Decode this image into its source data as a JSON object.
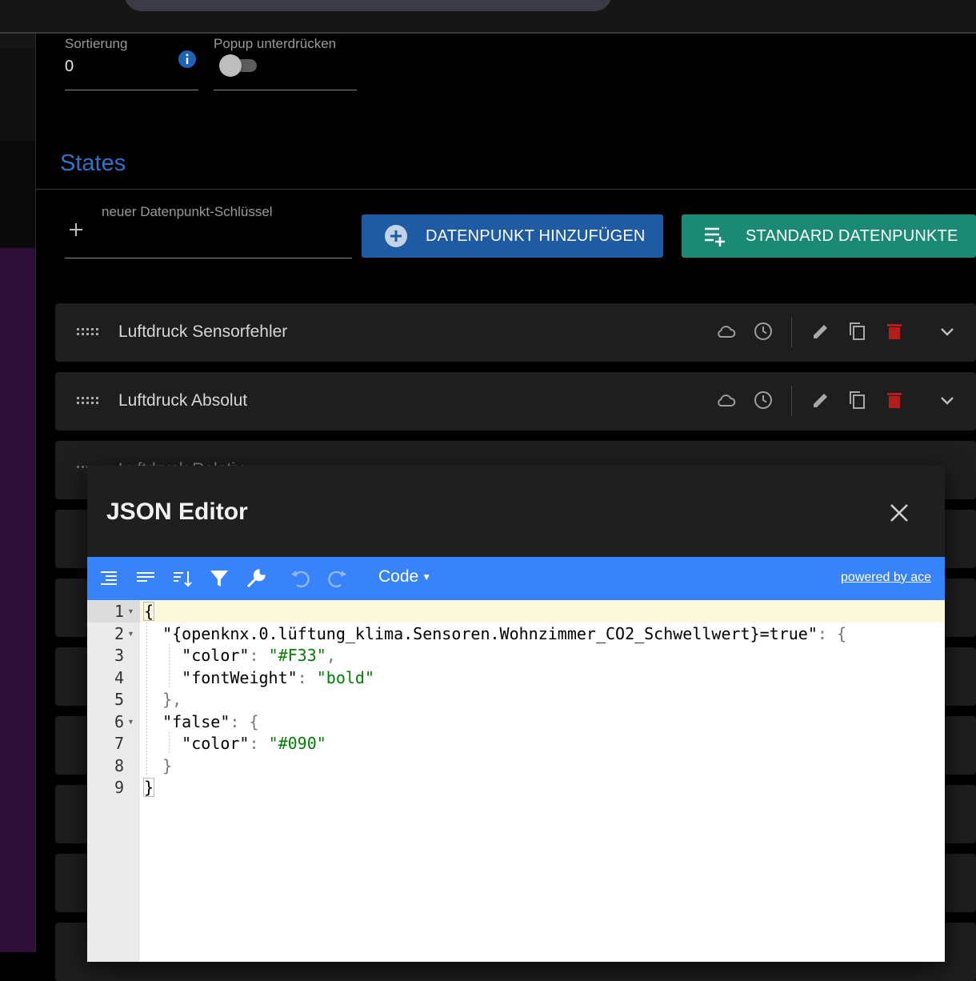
{
  "form": {
    "sort_label": "Sortierung",
    "sort_value": "0",
    "popup_label": "Popup unterdrücken",
    "popup_enabled": false
  },
  "states": {
    "section_title": "States",
    "new_key_placeholder": "neuer Datenpunkt-Schlüssel",
    "add_button": "DATENPUNKT HINZUFÜGEN",
    "standard_button": "STANDARD DATENPUNKTE",
    "rows": [
      {
        "title": "Luftdruck Sensorfehler"
      },
      {
        "title": "Luftdruck Absolut"
      },
      {
        "title": "Luftdruck Relativ"
      }
    ]
  },
  "dialog": {
    "title": "JSON Editor",
    "toolbar": {
      "mode": "Code",
      "powered_by": "powered by ace"
    },
    "line_numbers": [
      "1",
      "2",
      "3",
      "4",
      "5",
      "6",
      "7",
      "8",
      "9"
    ],
    "code": {
      "l1_open": "{",
      "l2_key": "\"{openknx.0.lüftung_klima.Sensoren.Wohnzimmer_CO2_Schwellwert}=true\"",
      "l2_rest": ": {",
      "l3_key": "\"color\"",
      "l3_colon": ": ",
      "l3_val": "\"#F33\"",
      "l3_comma": ",",
      "l4_key": "\"fontWeight\"",
      "l4_colon": ": ",
      "l4_val": "\"bold\"",
      "l5": "},",
      "l6_key": "\"false\"",
      "l6_rest": ": {",
      "l7_key": "\"color\"",
      "l7_colon": ": ",
      "l7_val": "\"#090\"",
      "l8": "}",
      "l9_close": "}"
    }
  },
  "colors": {
    "accent_blue": "#2f73c4",
    "button_blue": "#1e5ba3",
    "button_teal": "#1b8a75",
    "delete_red": "#b71c1c",
    "editor_toolbar": "#3883fa"
  },
  "icons": {
    "row_actions": [
      "cloud-icon",
      "history-icon",
      "edit-icon",
      "copy-icon",
      "delete-icon",
      "chevron-down-icon"
    ],
    "toolbar": [
      "format-icon",
      "compact-icon",
      "sort-icon",
      "filter-icon",
      "repair-icon",
      "undo-icon",
      "redo-icon"
    ]
  }
}
